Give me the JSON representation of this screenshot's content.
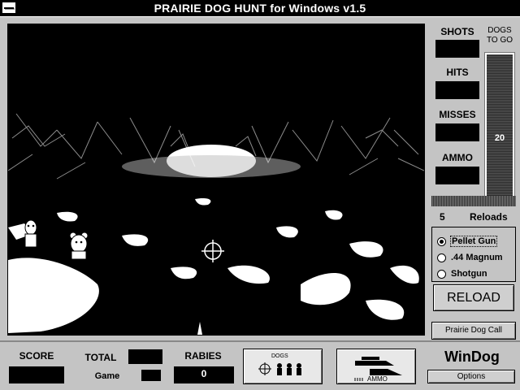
{
  "window": {
    "title": "PRAIRIE DOG HUNT for Windows v1.5"
  },
  "stats": {
    "shots_label": "SHOTS",
    "hits_label": "HITS",
    "misses_label": "MISSES",
    "ammo_label": "AMMO",
    "dogs_to_go_label_1": "DOGS",
    "dogs_to_go_label_2": "TO GO",
    "dogs_to_go_value": "20"
  },
  "reloads": {
    "count": "5",
    "label": "Reloads"
  },
  "weapons": {
    "options": [
      "Pellet Gun",
      ".44 Magnum",
      "Shotgun"
    ],
    "selected": "Pellet Gun"
  },
  "buttons": {
    "reload": "RELOAD",
    "prairie_dog_call": "Prairie Dog Call",
    "options": "Options"
  },
  "score": {
    "score_label": "SCORE",
    "total_label": "TOTAL",
    "game_label": "Game",
    "rabies_label": "RABIES",
    "rabies_value": "0"
  },
  "bottom_icons": {
    "dogs_label": "DOGS",
    "ammo_label": "AMMO"
  },
  "brand": "WinDog",
  "icons": [
    "crosshair-icon",
    "prairie-dog-icon",
    "rifle-icon",
    "system-menu-icon"
  ]
}
